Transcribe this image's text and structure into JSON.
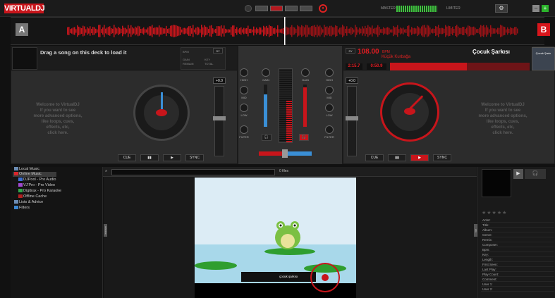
{
  "app": {
    "logo": "VIRTUALDJ",
    "master_label": "MASTER",
    "limiter_label": "LIMITER"
  },
  "top_controls": {
    "settings_icon": "gear-icon",
    "minimize": "–",
    "maximize": "+"
  },
  "decks": {
    "a": {
      "label": "A",
      "title": "Drag a song on this deck to load it",
      "bpm_label": "BPM",
      "key_label": "KEY",
      "gain_label": "GAIN",
      "remain_label": "REMAIN",
      "total_label": "TOTAL",
      "sync_small": "SY",
      "pitch": "+0.0",
      "welcome": [
        "Welcome to VirtualDJ",
        "If you want to see",
        "more advanced options,",
        "like loops, cues,",
        "effects, etc,",
        "click here."
      ],
      "buttons": {
        "cue": "CUE",
        "pause": "▮▮",
        "play": "▶",
        "sync": "SYNC"
      }
    },
    "b": {
      "label": "B",
      "bpm": "108.00",
      "bpm_unit": "BPM",
      "sync_small": "SY",
      "song": "Küçük Kurbağa",
      "title": "Çocuk Şarkısı",
      "side_label": "Çocuk Şarkı",
      "elapsed": "2:15.7",
      "remain": "0:50.9",
      "pitch": "+0.0",
      "welcome": [
        "Welcome to VirtualDJ",
        "If you want to see",
        "more advanced options,",
        "like loops, cues,",
        "effects, etc,",
        "click here."
      ],
      "buttons": {
        "cue": "CUE",
        "pause": "▮▮",
        "play": "▶",
        "sync": "SYNC"
      }
    }
  },
  "mixer": {
    "gain": "GAIN",
    "high": "HIGH",
    "mid": "MID",
    "low": "LOW",
    "filter": "FILTER"
  },
  "browser": {
    "search_placeholder": "",
    "files_count": "0 files",
    "tree": [
      {
        "label": "Local Music",
        "color": "#6c8db5"
      },
      {
        "label": "Online Music",
        "color": "#d9262c"
      },
      {
        "label": "DJPool - Pro Audio",
        "color": "#3b6fd1"
      },
      {
        "label": "VJ'Pro - Pro Video",
        "color": "#a04ad0"
      },
      {
        "label": "Digitrax - Pro Karaoke",
        "color": "#2fa84a"
      },
      {
        "label": "Offline Cache",
        "color": "#b32121"
      },
      {
        "label": "Lists & Advice",
        "color": "#6c8db5"
      },
      {
        "label": "Filters",
        "color": "#3b86d1"
      }
    ],
    "video_overlay": "çocuk şarkısı",
    "side_tab_left": "sideview",
    "side_tab_right": "info"
  },
  "info_panel": {
    "stars": "★★★★★",
    "fields": [
      "Artist:",
      "Title:",
      "Album:",
      "Genre:",
      "Remix:",
      "Composer:",
      "Bpm:",
      "Key:",
      "Length:",
      "First Seen:",
      "Last Play:",
      "Play Count:",
      "Comment:",
      "User 1:",
      "User 2:"
    ]
  }
}
